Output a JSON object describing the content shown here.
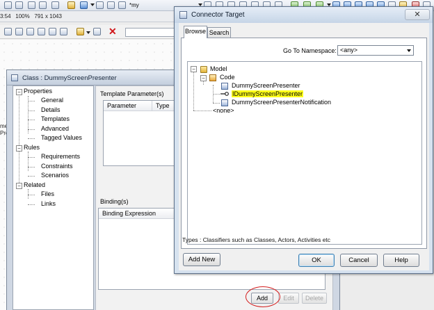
{
  "toolbar": {
    "combo_value": "*my",
    "zoom_info": "3:54   100%   791 x 1043"
  },
  "canvas": {
    "labels": "me\nPre"
  },
  "class_dialog": {
    "title": "Class : DummyScreenPresenter",
    "tree": [
      {
        "label": "Properties",
        "level": 0,
        "expanded": true
      },
      {
        "label": "General",
        "level": 1
      },
      {
        "label": "Details",
        "level": 1
      },
      {
        "label": "Templates",
        "level": 1
      },
      {
        "label": "Advanced",
        "level": 1
      },
      {
        "label": "Tagged Values",
        "level": 1
      },
      {
        "label": "Rules",
        "level": 0,
        "expanded": true
      },
      {
        "label": "Requirements",
        "level": 1
      },
      {
        "label": "Constraints",
        "level": 1
      },
      {
        "label": "Scenarios",
        "level": 1
      },
      {
        "label": "Related",
        "level": 0,
        "expanded": true
      },
      {
        "label": "Files",
        "level": 1
      },
      {
        "label": "Links",
        "level": 1
      }
    ],
    "template_group_label": "Template Parameter(s)",
    "template_columns": [
      "Parameter",
      "Type"
    ],
    "binding_group_label": "Binding(s)",
    "binding_columns": [
      "Binding Expression"
    ],
    "buttons": {
      "add": "Add",
      "edit": "Edit",
      "delete": "Delete"
    }
  },
  "connector_dialog": {
    "title": "Connector Target",
    "close_glyph": "✕",
    "tabs": [
      "Browse",
      "Search"
    ],
    "active_tab": "Browse",
    "namespace_label": "Go To Namespace:",
    "namespace_value": "<any>",
    "tree": {
      "model": "Model",
      "code": "Code",
      "items": [
        "DummyScreenPresenter",
        "IDummyScreenPresenter",
        "DummyScreenPresenterNotification"
      ],
      "selected": "IDummyScreenPresenter",
      "none": "<none>"
    },
    "types_hint": "Types : Classifiers such as Classes, Actors, Activities etc",
    "buttons": {
      "add_new": "Add New",
      "ok": "OK",
      "cancel": "Cancel",
      "help": "Help"
    }
  },
  "colors": {
    "highlight": "#ffff1a",
    "annotation_circle": "#d41e1e",
    "delete_red": "#d0161a"
  }
}
